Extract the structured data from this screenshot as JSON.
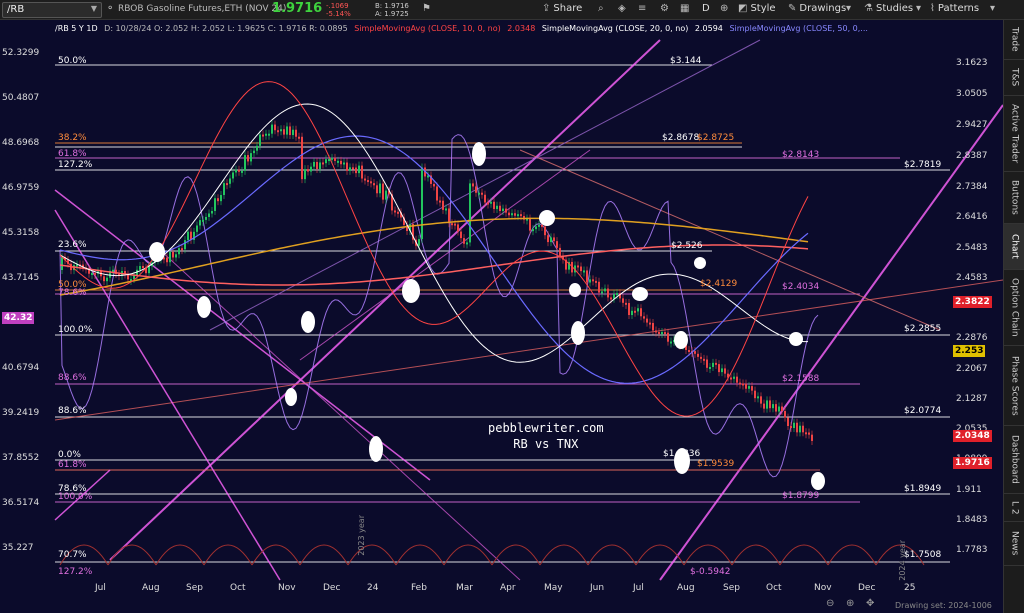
{
  "toolbar": {
    "symbol": "/RB",
    "description": "RBOB Gasoline Futures,ETH (NOV 24)",
    "last": "1.9716",
    "change_abs": "-.1069",
    "change_pct": "-5.14%",
    "bid": "B: 1.9716",
    "ask": "A: 1.9725",
    "share_label": "Share",
    "period_label": "D",
    "style_label": "Style",
    "drawings_label": "Drawings",
    "studies_label": "Studies",
    "patterns_label": "Patterns"
  },
  "legend": {
    "symbol": "/RB 5 Y 1D",
    "ohlc": "D: 10/28/24   O: 2.052   H: 2.052   L: 1.9625   C: 1.9716   R: 0.0895",
    "sma10": "SimpleMovingAvg (CLOSE, 10, 0, no)",
    "sma10_value": "2.0348",
    "sma20": "SimpleMovingAvg (CLOSE, 20, 0, no)",
    "sma20_value": "2.0594",
    "sma50": "SimpleMovingAvg (CLOSE, 50, 0,..."
  },
  "left_axis": [
    "52.3299",
    "50.4807",
    "48.6968",
    "46.9759",
    "45.3158",
    "43.7145",
    "40.6794",
    "39.2419",
    "37.8552",
    "36.5174",
    "35.227"
  ],
  "left_badge": "42.32",
  "right_axis": [
    "3.1623",
    "3.0505",
    "2.9427",
    "2.8387",
    "2.7384",
    "2.6416",
    "2.5483",
    "2.4583",
    "2.2876",
    "2.2067",
    "2.1287",
    "2.0535",
    "1.9809",
    "1.911",
    "1.8483",
    "1.7783"
  ],
  "right_badges": {
    "sma50": "2.3822",
    "sma20": "2.253",
    "sma10": "2.0348",
    "last": "1.9716"
  },
  "x_axis": [
    "Jul",
    "Aug",
    "Sep",
    "Oct",
    "Nov",
    "Dec",
    "24",
    "Feb",
    "Mar",
    "Apr",
    "May",
    "Jun",
    "Jul",
    "Aug",
    "Sep",
    "Oct",
    "Nov",
    "Dec",
    "25"
  ],
  "fib_left": [
    "50.0%",
    "38.2%",
    "61.8%",
    "127.2%",
    "23.6%",
    "50.0%",
    "78.6%",
    "100.0%",
    "88.6%",
    "88.6%",
    "0.0%",
    "61.8%",
    "78.6%",
    "100.0%",
    "70.7%",
    "127.2%"
  ],
  "price_annotations": [
    "$3.144",
    "$2.8678",
    "$2.8725",
    "$2.8143",
    "$2.7819",
    "$2.526",
    "$2.4129",
    "$2.4034",
    "$2.2855",
    "$2.1588",
    "$2.0774",
    "$1.9836",
    "$1.9539",
    "$1.8949",
    "$1.8799",
    "$1.7508",
    "$-0.5942"
  ],
  "watermark": {
    "line1": "pebblewriter.com",
    "line2": "RB vs TNX"
  },
  "year_labels": [
    "2023 year",
    "2024 year"
  ],
  "drawing_set": "Drawing set: 2024-1006",
  "sidebar": [
    "Trade",
    "T&S",
    "Active Trader",
    "Buttons",
    "Chart",
    "Option Chain",
    "Phase Scores",
    "Dashboard",
    "L 2",
    "News"
  ],
  "colors": {
    "background": "#0b0b2b",
    "up": "#22c55e",
    "down": "#ef4444",
    "sma10": "#ff4444",
    "sma20": "#ffffff",
    "sma50": "#6a6aff",
    "sma200": "#e0a020",
    "fib": "#cc66cc",
    "tnx": "#b080ff"
  }
}
